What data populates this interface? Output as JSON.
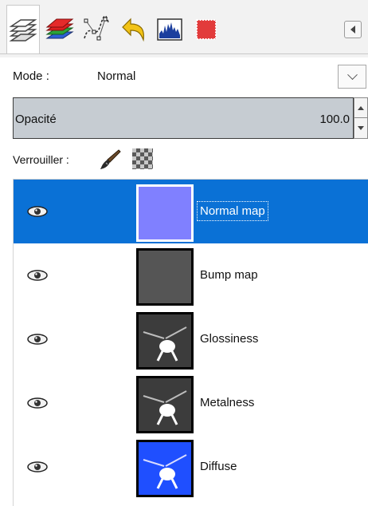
{
  "tabs": [
    {
      "icon": "layers-icon",
      "active": true
    },
    {
      "icon": "channels-icon",
      "active": false
    },
    {
      "icon": "paths-icon",
      "active": false
    },
    {
      "icon": "undo-history-icon",
      "active": false
    },
    {
      "icon": "histogram-icon",
      "active": false
    },
    {
      "icon": "color-swatch-icon",
      "active": false
    }
  ],
  "mode": {
    "label": "Mode :",
    "value": "Normal"
  },
  "opacity": {
    "label": "Opacité",
    "value": "100.0"
  },
  "lock": {
    "label": "Verrouiller :"
  },
  "layers": [
    {
      "name": "Normal map",
      "selected": true,
      "thumb_color": "#8080ff"
    },
    {
      "name": "Bump map",
      "selected": false,
      "thumb_color": "#555555"
    },
    {
      "name": "Glossiness",
      "selected": false,
      "thumb_color": "#3c3c3c"
    },
    {
      "name": "Metalness",
      "selected": false,
      "thumb_color": "#3c3c3c"
    },
    {
      "name": "Diffuse",
      "selected": false,
      "thumb_color": "#1f4fff"
    }
  ],
  "colors": {
    "selection": "#0a71d6",
    "opacity_bar": "#c6ccd2"
  }
}
